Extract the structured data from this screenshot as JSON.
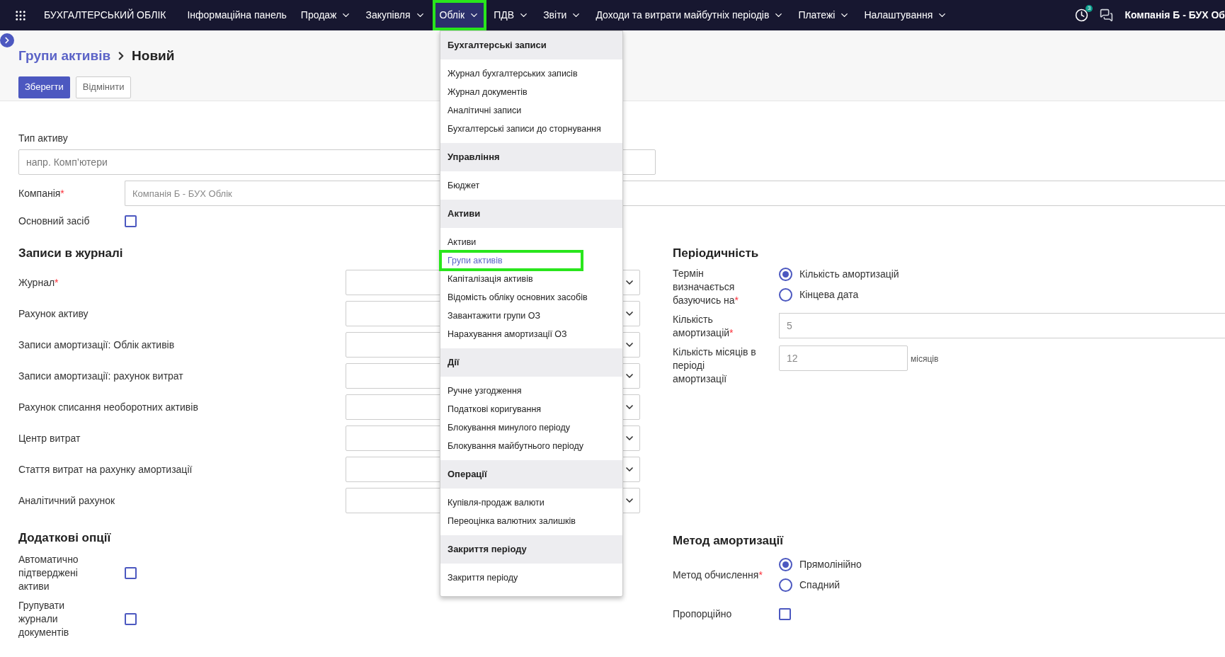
{
  "navbar": {
    "app_title": "БУХГАЛТЕРСЬКИЙ ОБЛІК",
    "menus": [
      {
        "label": "Інформаційна панель",
        "dropdown": false,
        "selected": false,
        "highlighted": false
      },
      {
        "label": "Продаж",
        "dropdown": true,
        "selected": false,
        "highlighted": false
      },
      {
        "label": "Закупівля",
        "dropdown": true,
        "selected": false,
        "highlighted": false
      },
      {
        "label": "Облік",
        "dropdown": true,
        "selected": true,
        "highlighted": true
      },
      {
        "label": "ПДВ",
        "dropdown": true,
        "selected": false,
        "highlighted": false
      },
      {
        "label": "Звіти",
        "dropdown": true,
        "selected": false,
        "highlighted": false
      },
      {
        "label": "Доходи та витрати майбутніх періодів",
        "dropdown": true,
        "selected": false,
        "highlighted": false
      },
      {
        "label": "Платежі",
        "dropdown": true,
        "selected": false,
        "highlighted": false
      },
      {
        "label": "Налаштування",
        "dropdown": true,
        "selected": false,
        "highlighted": false
      }
    ],
    "activity_badge": "3",
    "company": "Компанія Б - БУХ Об"
  },
  "breadcrumb": {
    "parent": "Групи активів",
    "current": "Новий"
  },
  "actions": [
    {
      "label": "Зберегти",
      "kind": "primary"
    },
    {
      "label": "Відмінити",
      "kind": "secondary"
    }
  ],
  "form": {
    "asset_type": {
      "label": "Тип активу",
      "placeholder": "напр. Комп’ютери"
    },
    "company": {
      "label": "Компанія",
      "required_mark": "*",
      "value": "Компанія Б - БУХ Облік"
    },
    "fixed_asset": {
      "label": "Основний засіб",
      "checked": false
    },
    "journal_section": {
      "title": "Записи в журналі",
      "fields": [
        {
          "label": "Журнал",
          "required_mark": "*"
        },
        {
          "label": "Рахунок активу"
        },
        {
          "label": "Записи амортизації: Облік активів"
        },
        {
          "label": "Записи амортизації: рахунок витрат"
        },
        {
          "label": "Рахунок списання необоротних активів"
        },
        {
          "label": "Центр витрат"
        },
        {
          "label": "Стаття витрат на рахунку амортизації"
        },
        {
          "label": "Аналітичний рахунок"
        }
      ]
    },
    "options_section": {
      "title": "Додаткові опції",
      "fields": [
        {
          "label": "Автоматично підтверджені активи",
          "checked": false
        },
        {
          "label": "Групувати журнали документів",
          "checked": false
        }
      ]
    },
    "periodicity": {
      "title": "Періодичність",
      "term": {
        "label": "Термін визначається базуючись на",
        "required_mark": "*",
        "options": [
          {
            "label": "Кількість амортизацій",
            "selected": true
          },
          {
            "label": "Кінцева дата",
            "selected": false
          }
        ]
      },
      "count": {
        "label": "Кількість амортизацій",
        "required_mark": "*",
        "value": "5"
      },
      "months": {
        "label": "Кількість місяців в періоді амортизації",
        "value": "12",
        "unit": "місяців"
      }
    },
    "method_section": {
      "title": "Метод амортизації",
      "method": {
        "label": "Метод обчислення",
        "required_mark": "*",
        "options": [
          {
            "label": "Прямолінійно",
            "selected": true
          },
          {
            "label": "Спадний",
            "selected": false
          }
        ]
      },
      "prorata": {
        "label": "Пропорційно",
        "checked": false
      }
    }
  },
  "dropdown": {
    "sections": [
      {
        "title": "Бухгалтерські записи",
        "items": [
          {
            "label": "Журнал бухгалтерських записів",
            "selected": false,
            "highlighted": false
          },
          {
            "label": "Журнал документів",
            "selected": false,
            "highlighted": false
          },
          {
            "label": "Аналітичні записи",
            "selected": false,
            "highlighted": false
          },
          {
            "label": "Бухгалтерські записи до сторнування",
            "selected": false,
            "highlighted": false
          }
        ]
      },
      {
        "title": "Управління",
        "items": [
          {
            "label": "Бюджет",
            "selected": false,
            "highlighted": false
          }
        ]
      },
      {
        "title": "Активи",
        "items": [
          {
            "label": "Активи",
            "selected": false,
            "highlighted": false
          },
          {
            "label": "Групи активів",
            "selected": true,
            "highlighted": true
          },
          {
            "label": "Капіталізація активів",
            "selected": false,
            "highlighted": false
          },
          {
            "label": "Відомість обліку основних засобів",
            "selected": false,
            "highlighted": false
          },
          {
            "label": "Завантажити групи ОЗ",
            "selected": false,
            "highlighted": false
          },
          {
            "label": "Нарахування амортизації ОЗ",
            "selected": false,
            "highlighted": false
          }
        ]
      },
      {
        "title": "Дії",
        "items": [
          {
            "label": "Ручне узгодження",
            "selected": false,
            "highlighted": false
          },
          {
            "label": "Податкові коригування",
            "selected": false,
            "highlighted": false
          },
          {
            "label": "Блокування минулого періоду",
            "selected": false,
            "highlighted": false
          },
          {
            "label": "Блокування майбутнього періоду",
            "selected": false,
            "highlighted": false
          }
        ]
      },
      {
        "title": "Операції",
        "items": [
          {
            "label": "Купівля-продаж валюти",
            "selected": false,
            "highlighted": false
          },
          {
            "label": "Переоцінка валютних залишків",
            "selected": false,
            "highlighted": false
          }
        ]
      },
      {
        "title": "Закриття періоду",
        "items": [
          {
            "label": "Закриття періоду",
            "selected": false,
            "highlighted": false
          }
        ]
      }
    ]
  }
}
